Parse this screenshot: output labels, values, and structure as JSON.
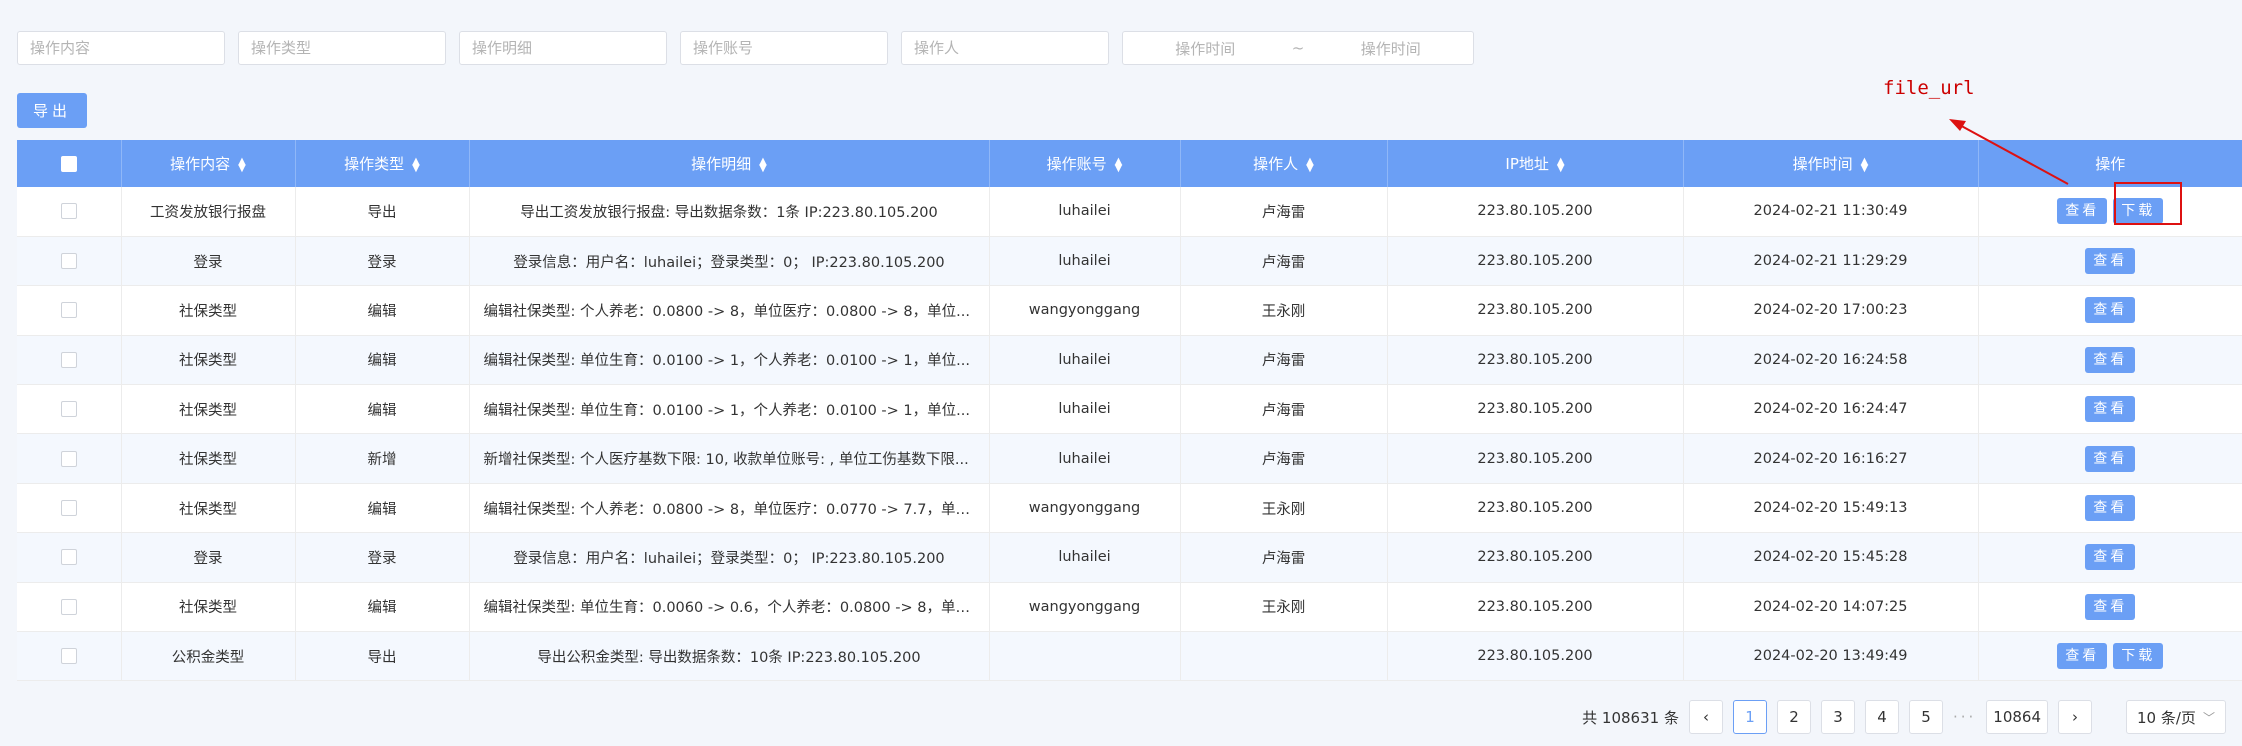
{
  "filters": {
    "placeholders": [
      "操作内容",
      "操作类型",
      "操作明细",
      "操作账号",
      "操作人"
    ],
    "date_start": "操作时间",
    "date_sep": "~",
    "date_end": "操作时间"
  },
  "toolbar": {
    "export_label": "导出"
  },
  "table": {
    "headers": [
      "操作内容",
      "操作类型",
      "操作明细",
      "操作账号",
      "操作人",
      "IP地址",
      "操作时间",
      "操作"
    ],
    "view_label": "查看",
    "download_label": "下载",
    "rows": [
      {
        "content": "工资发放银行报盘",
        "type": "导出",
        "detail": "导出工资发放银行报盘: 导出数据条数：1条 IP:223.80.105.200",
        "account": "luhailei",
        "operator": "卢海雷",
        "ip": "223.80.105.200",
        "time": "2024-02-21 11:30:49",
        "download": true
      },
      {
        "content": "登录",
        "type": "登录",
        "detail": "登录信息：用户名：luhailei；登录类型：0； IP:223.80.105.200",
        "account": "luhailei",
        "operator": "卢海雷",
        "ip": "223.80.105.200",
        "time": "2024-02-21 11:29:29",
        "download": false
      },
      {
        "content": "社保类型",
        "type": "编辑",
        "detail": "编辑社保类型: 个人养老：0.0800 -> 8，单位医疗：0.0800 -> 8，单位...",
        "account": "wangyonggang",
        "operator": "王永刚",
        "ip": "223.80.105.200",
        "time": "2024-02-20 17:00:23",
        "download": false
      },
      {
        "content": "社保类型",
        "type": "编辑",
        "detail": "编辑社保类型: 单位生育：0.0100 -> 1，个人养老：0.0100 -> 1，单位...",
        "account": "luhailei",
        "operator": "卢海雷",
        "ip": "223.80.105.200",
        "time": "2024-02-20 16:24:58",
        "download": false
      },
      {
        "content": "社保类型",
        "type": "编辑",
        "detail": "编辑社保类型: 单位生育：0.0100 -> 1，个人养老：0.0100 -> 1，单位...",
        "account": "luhailei",
        "operator": "卢海雷",
        "ip": "223.80.105.200",
        "time": "2024-02-20 16:24:47",
        "download": false
      },
      {
        "content": "社保类型",
        "type": "新增",
        "detail": "新增社保类型: 个人医疗基数下限: 10, 收款单位账号: , 单位工伤基数下限...",
        "account": "luhailei",
        "operator": "卢海雷",
        "ip": "223.80.105.200",
        "time": "2024-02-20 16:16:27",
        "download": false
      },
      {
        "content": "社保类型",
        "type": "编辑",
        "detail": "编辑社保类型: 个人养老：0.0800 -> 8，单位医疗：0.0770 -> 7.7，单位...",
        "account": "wangyonggang",
        "operator": "王永刚",
        "ip": "223.80.105.200",
        "time": "2024-02-20 15:49:13",
        "download": false
      },
      {
        "content": "登录",
        "type": "登录",
        "detail": "登录信息：用户名：luhailei；登录类型：0； IP:223.80.105.200",
        "account": "luhailei",
        "operator": "卢海雷",
        "ip": "223.80.105.200",
        "time": "2024-02-20 15:45:28",
        "download": false
      },
      {
        "content": "社保类型",
        "type": "编辑",
        "detail": "编辑社保类型: 单位生育：0.0060 -> 0.6，个人养老：0.0800 -> 8，单位...",
        "account": "wangyonggang",
        "operator": "王永刚",
        "ip": "223.80.105.200",
        "time": "2024-02-20 14:07:25",
        "download": false
      },
      {
        "content": "公积金类型",
        "type": "导出",
        "detail": "导出公积金类型: 导出数据条数：10条 IP:223.80.105.200",
        "account": "",
        "operator": "",
        "ip": "223.80.105.200",
        "time": "2024-02-20 13:49:49",
        "download": true
      }
    ]
  },
  "pagination": {
    "total_text": "共 108631 条",
    "pages": [
      "1",
      "2",
      "3",
      "4",
      "5"
    ],
    "active_page": "1",
    "dots": "···",
    "last_page": "10864",
    "page_size": "10 条/页"
  },
  "annotation": {
    "label": "file_url",
    "color": "#cc0000"
  },
  "colors": {
    "primary": "#6b9ff5",
    "annotation": "#dd1111"
  }
}
